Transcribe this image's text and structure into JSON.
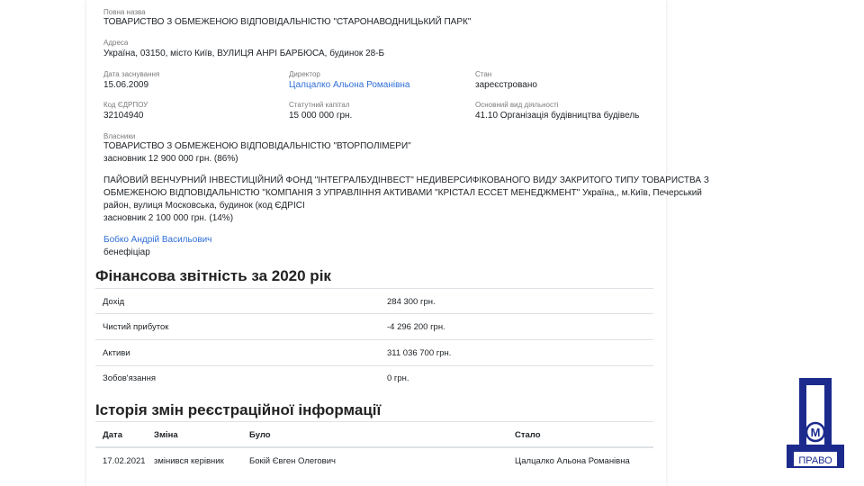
{
  "company": {
    "full_name_label": "Повна назва",
    "full_name": "ТОВАРИСТВО З ОБМЕЖЕНОЮ ВІДПОВІДАЛЬНІСТЮ \"СТАРОНАВОДНИЦЬКИЙ ПАРК\"",
    "address_label": "Адреса",
    "address": "Україна, 03150, місто Київ, ВУЛИЦЯ АНРІ БАРБЮСА, будинок 28-Б",
    "founded_label": "Дата заснування",
    "founded": "15.06.2009",
    "director_label": "Директор",
    "director": "Цалцалко Альона Романівна",
    "status_label": "Стан",
    "status": "зареєстровано",
    "edrpou_label": "Код ЄДРПОУ",
    "edrpou": "32104940",
    "capital_label": "Статутний капітал",
    "capital": "15 000 000 грн.",
    "activity_label": "Основний вид діяльності",
    "activity": "41.10 Організація будівництва будівель",
    "owners_label": "Власники",
    "owner1_name": "ТОВАРИСТВО З ОБМЕЖЕНОЮ ВІДПОВІДАЛЬНІСТЮ \"ВТОРПОЛІМЕРИ\"",
    "owner1_share": "засновник 12 900 000 грн. (86%)",
    "owner2_line1": "ПАЙОВИЙ ВЕНЧУРНИЙ ІНВЕСТИЦІЙНИЙ ФОНД \"ІНТЕГРАЛБУДІНВЕСТ\" НЕДИВЕРСИФІКОВАНОГО ВИДУ ЗАКРИТОГО ТИПУ ТОВАРИСТВА З",
    "owner2_line2": "ОБМЕЖЕНОЮ ВІДПОВІДАЛЬНІСТЮ \"КОМПАНІЯ З УПРАВЛІННЯ АКТИВАМИ \"КРІСТАЛ ЕССЕТ МЕНЕДЖМЕНТ\" Україна,, м.Київ, Печерський",
    "owner2_line3": "район, вулиця Московська, будинок (код ЄДРІСІ",
    "owner2_share": "засновник 2 100 000 грн. (14%)",
    "beneficiary_name": "Бобко Андрій Васильович",
    "beneficiary_role": "бенефіціар"
  },
  "finance": {
    "title": "Фінансова звітність за 2020 рік",
    "rows": [
      {
        "label": "Дохід",
        "value": "284 300 грн."
      },
      {
        "label": "Чистий прибуток",
        "value": "-4 296 200 грн."
      },
      {
        "label": "Активи",
        "value": "311 036 700 грн."
      },
      {
        "label": "Зобов'язання",
        "value": "0 грн."
      }
    ]
  },
  "history": {
    "title": "Історія змін реєстраційної інформації",
    "headers": [
      "Дата",
      "Зміна",
      "Було",
      "Стало"
    ],
    "rows": [
      {
        "date": "17.02.2021",
        "change": "змінився керівник",
        "before": "Бокій Євген Олегович",
        "after": "Цалцалко Альона Романівна"
      }
    ]
  },
  "logo": {
    "letter": "Д",
    "monogram": "М",
    "caption": "ПРАВО",
    "color": "#1b2a8c"
  },
  "colors": {
    "link": "#2f6fd6"
  }
}
